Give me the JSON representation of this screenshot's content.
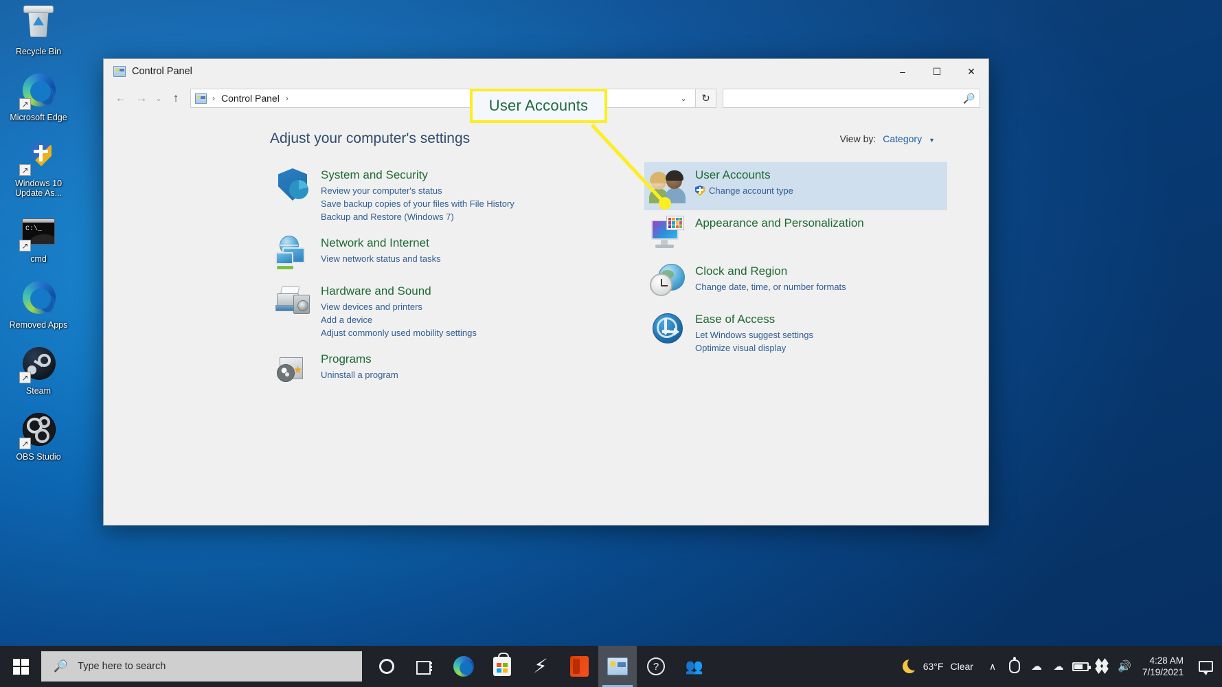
{
  "desktop": {
    "icons": [
      {
        "label": "Recycle Bin",
        "icon": "recycle-bin-icon"
      },
      {
        "label": "Microsoft Edge",
        "icon": "microsoft-edge-icon"
      },
      {
        "label": "Windows 10 Update As...",
        "icon": "windows-update-shield-icon"
      },
      {
        "label": "cmd",
        "icon": "command-prompt-icon"
      },
      {
        "label": "Removed Apps",
        "icon": "microsoft-edge-icon"
      },
      {
        "label": "Steam",
        "icon": "steam-icon"
      },
      {
        "label": "OBS Studio",
        "icon": "obs-studio-icon"
      }
    ]
  },
  "window": {
    "title": "Control Panel",
    "title_icon": "control-panel-icon",
    "buttons": {
      "minimize": "‒",
      "maximize": "☐",
      "close": "✕"
    },
    "nav": {
      "back": "←",
      "forward": "→",
      "recent": "⌄",
      "up": "↑"
    },
    "breadcrumb": {
      "icon": "control-panel-icon",
      "items": [
        "Control Panel"
      ],
      "separator": "›",
      "dropdown_caret": "⌄"
    },
    "refresh_icon": "↻",
    "search": {
      "placeholder": "",
      "value": "",
      "icon": "search-icon"
    }
  },
  "content": {
    "heading": "Adjust your computer's settings",
    "view_by": {
      "label": "View by:",
      "value": "Category",
      "caret": "▼"
    },
    "left_column": [
      {
        "title": "System and Security",
        "icon": "shield-security-icon",
        "links": [
          "Review your computer's status",
          "Save backup copies of your files with File History",
          "Backup and Restore (Windows 7)"
        ]
      },
      {
        "title": "Network and Internet",
        "icon": "network-globe-icon",
        "links": [
          "View network status and tasks"
        ]
      },
      {
        "title": "Hardware and Sound",
        "icon": "printer-speaker-icon",
        "links": [
          "View devices and printers",
          "Add a device",
          "Adjust commonly used mobility settings"
        ]
      },
      {
        "title": "Programs",
        "icon": "programs-disc-icon",
        "links": [
          "Uninstall a program"
        ]
      }
    ],
    "right_column": [
      {
        "title": "User Accounts",
        "icon": "user-accounts-people-icon",
        "highlighted": true,
        "links": [
          "Change account type"
        ],
        "link_shield": true
      },
      {
        "title": "Appearance and Personalization",
        "icon": "appearance-monitor-icon",
        "links": []
      },
      {
        "title": "Clock and Region",
        "icon": "clock-globe-icon",
        "links": [
          "Change date, time, or number formats"
        ]
      },
      {
        "title": "Ease of Access",
        "icon": "ease-of-access-icon",
        "links": [
          "Let Windows suggest settings",
          "Optimize visual display"
        ]
      }
    ]
  },
  "callout": {
    "text": "User Accounts",
    "border_color": "#fcee21",
    "text_color": "#1f6b3a",
    "background": "#f4f8fd"
  },
  "taskbar": {
    "start_label": "Start",
    "search": {
      "placeholder": "Type here to search",
      "icon": "search-icon"
    },
    "items": [
      {
        "name": "cortana-icon",
        "label": "Cortana"
      },
      {
        "name": "task-view-icon",
        "label": "Task View"
      },
      {
        "name": "microsoft-edge-icon",
        "label": "Microsoft Edge"
      },
      {
        "name": "microsoft-store-icon",
        "label": "Microsoft Store"
      },
      {
        "name": "lightning-bolt-icon",
        "label": "App"
      },
      {
        "name": "office-icon",
        "label": "Office"
      },
      {
        "name": "control-panel-icon",
        "label": "Control Panel",
        "active": true
      },
      {
        "name": "help-icon",
        "label": "Get Help"
      },
      {
        "name": "people-icon",
        "label": "People"
      }
    ],
    "tray": {
      "weather": {
        "icon": "moon-icon",
        "temperature": "63°F",
        "condition": "Clear"
      },
      "show_hidden_icons": "∧",
      "icons": [
        {
          "name": "stylus-icon"
        },
        {
          "name": "wifi-icon",
          "glyph": "ᵙ"
        },
        {
          "name": "onedrive-cloud-icon",
          "glyph": "☁"
        },
        {
          "name": "battery-icon"
        },
        {
          "name": "dropbox-icon"
        },
        {
          "name": "volume-icon",
          "glyph": "🔊"
        }
      ],
      "clock": {
        "time": "4:28 AM",
        "date": "7/19/2021"
      },
      "action_center": "notification-icon"
    }
  }
}
